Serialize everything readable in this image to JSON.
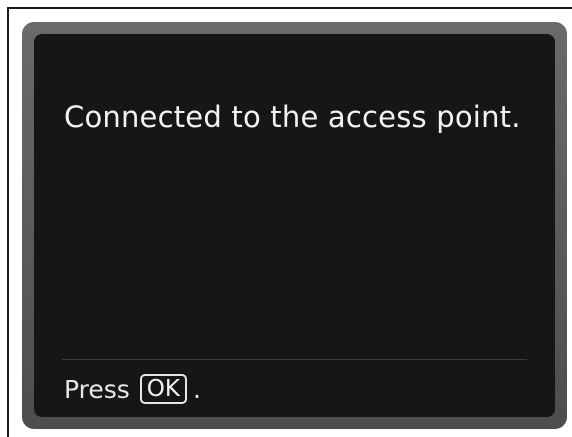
{
  "dialog": {
    "message": "Connected to the access point.",
    "footer": {
      "press_label": "Press",
      "key_label": "OK",
      "suffix": "."
    }
  },
  "colors": {
    "screen_background": "#161616",
    "bezel": "#5a5a5a",
    "text": "#f2f2f2"
  }
}
